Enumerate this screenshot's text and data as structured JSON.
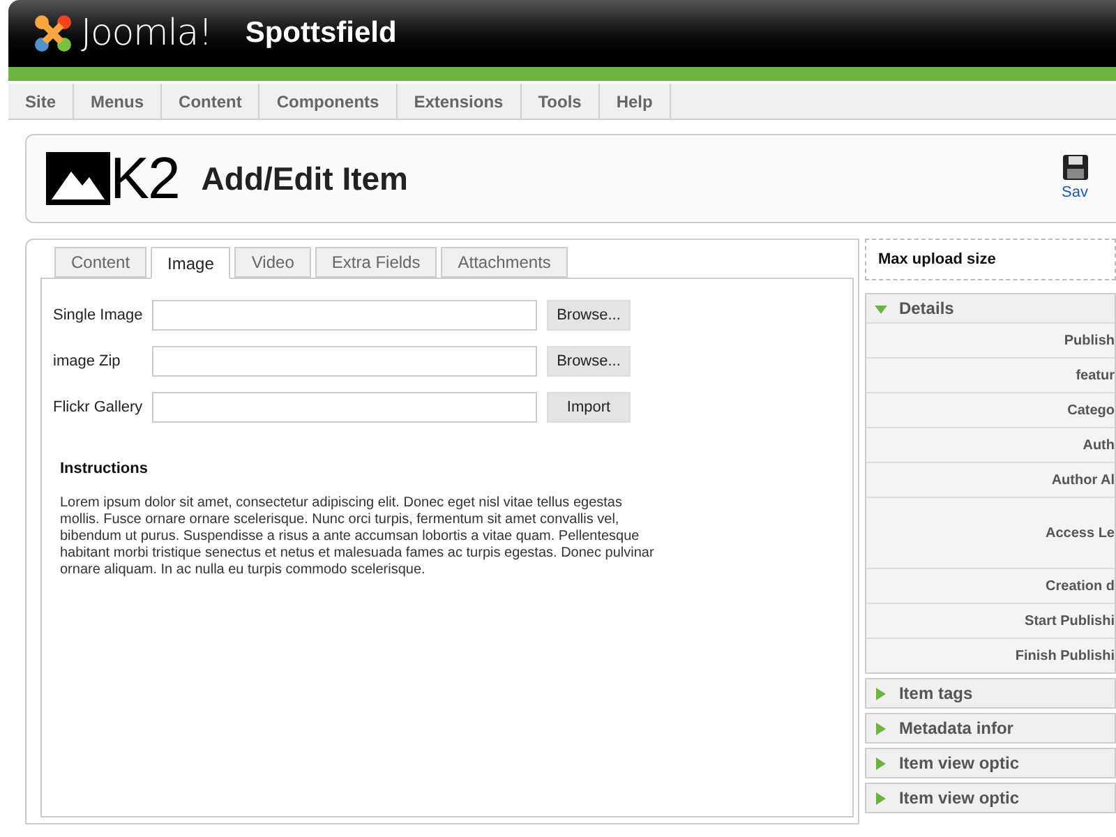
{
  "header": {
    "brand": "Joomla!",
    "site": "Spottsfield"
  },
  "menu": [
    "Site",
    "Menus",
    "Content",
    "Components",
    "Extensions",
    "Tools",
    "Help"
  ],
  "toolbar": {
    "logo": "K2",
    "title": "Add/Edit Item",
    "save": "Sav"
  },
  "tabs": [
    {
      "label": "Content",
      "selected": false
    },
    {
      "label": "Image",
      "selected": true
    },
    {
      "label": "Video",
      "selected": false
    },
    {
      "label": "Extra Fields",
      "selected": false
    },
    {
      "label": "Attachments",
      "selected": false
    }
  ],
  "fields": [
    {
      "label": "Single Image",
      "button": "Browse..."
    },
    {
      "label": "image Zip",
      "button": "Browse..."
    },
    {
      "label": "Flickr Gallery",
      "button": "Import"
    }
  ],
  "instructions": {
    "title": "Instructions",
    "text": "Lorem ipsum dolor sit amet, consectetur adipiscing elit. Donec eget nisl vitae tellus egestas mollis. Fusce ornare ornare scelerisque. Nunc orci turpis, fermentum sit amet convallis vel, bibendum ut purus. Suspendisse a risus a ante accumsan lobortis a vitae quam. Pellentesque habitant morbi tristique senectus et netus et malesuada fames ac turpis egestas. Donec pulvinar ornare aliquam. In ac nulla eu turpis commodo scelerisque."
  },
  "sidebar": {
    "upload": "Max upload size",
    "sections": [
      {
        "title": "Details",
        "expanded": true,
        "rows": [
          "Publish",
          "featur",
          "Catego",
          "Auth",
          "Author Al",
          "Access Le",
          "Creation d",
          "Start Publishi",
          "Finish Publishi"
        ]
      },
      {
        "title": "Item tags",
        "expanded": false
      },
      {
        "title": "Metadata infor",
        "expanded": false
      },
      {
        "title": "Item view optic",
        "expanded": false
      },
      {
        "title": "Item view optic",
        "expanded": false
      }
    ]
  }
}
